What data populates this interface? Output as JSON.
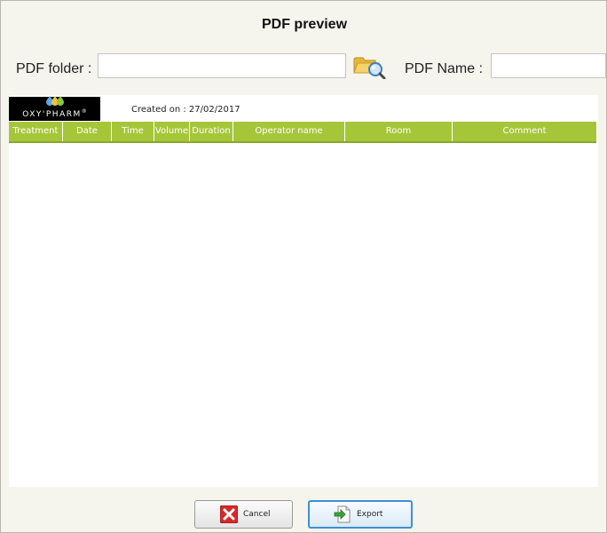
{
  "dialog": {
    "title": "PDF preview"
  },
  "form": {
    "pdf_folder_label": "PDF folder :",
    "pdf_folder_value": "",
    "pdf_name_label": "PDF Name :",
    "pdf_name_value": ""
  },
  "report": {
    "logo_text": "OXY'PHARM",
    "logo_mark": "®",
    "created_on": "Created on : 27/02/2017",
    "columns": [
      "Treatment",
      "Date",
      "Time",
      "Volume",
      "Duration",
      "Operator name",
      "Room",
      "Comment"
    ],
    "header_color": "#a6c63a"
  },
  "buttons": {
    "cancel": "Cancel",
    "export": "Export"
  },
  "icons": {
    "browse": "folder-search-icon",
    "cancel": "red-x-icon",
    "export": "export-arrow-icon"
  }
}
